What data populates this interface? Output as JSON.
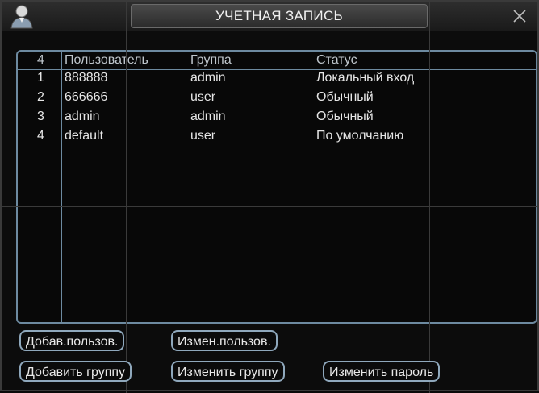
{
  "window": {
    "title": "УЧЕТНАЯ ЗАПИСЬ"
  },
  "table": {
    "count": "4",
    "headers": [
      "Пользователь",
      "Группа",
      "Статус"
    ],
    "rows": [
      {
        "index": "1",
        "user": "888888",
        "group": "admin",
        "status": "Локальный вход"
      },
      {
        "index": "2",
        "user": "666666",
        "group": "user",
        "status": "Обычный"
      },
      {
        "index": "3",
        "user": "admin",
        "group": "admin",
        "status": "Обычный"
      },
      {
        "index": "4",
        "user": "default",
        "group": "user",
        "status": "По умолчанию"
      }
    ]
  },
  "buttons": {
    "add_user": "Добав.пользов.",
    "edit_user": "Измен.пользов.",
    "add_group": "Добавить группу",
    "edit_group": "Изменить группу",
    "change_password": "Изменить пароль"
  },
  "colors": {
    "accent": "#8fa8bc",
    "background": "#0c0c0c",
    "text": "#e6e6e6"
  },
  "icons": {
    "user": "user-icon",
    "close": "close-icon"
  }
}
